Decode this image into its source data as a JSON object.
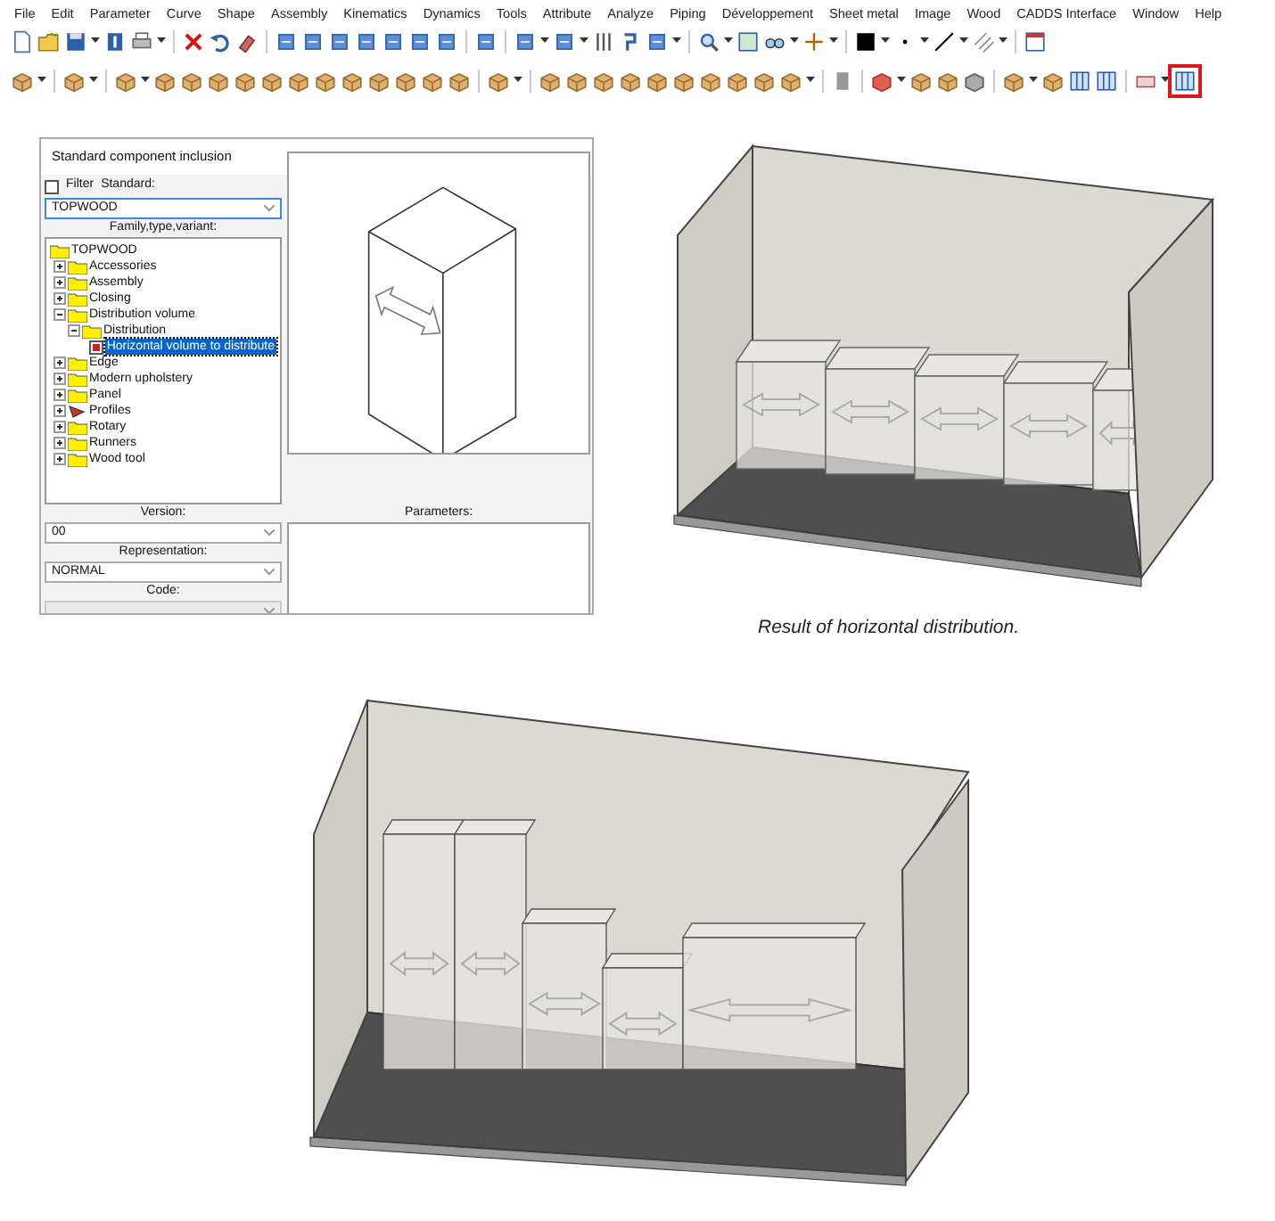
{
  "menu": [
    "File",
    "Edit",
    "Parameter",
    "Curve",
    "Shape",
    "Assembly",
    "Kinematics",
    "Dynamics",
    "Tools",
    "Attribute",
    "Analyze",
    "Piping",
    "Développement",
    "Sheet metal",
    "Image",
    "Wood",
    "CADDS Interface",
    "Window",
    "Help"
  ],
  "lower_toolbar": {
    "highlight_last": true
  },
  "dialog": {
    "title": "Standard component inclusion",
    "filter": {
      "label": "Filter",
      "checked": false
    },
    "standard": {
      "label": "Standard:",
      "value": "TOPWOOD"
    },
    "tree_label": "Family,type,variant:",
    "tree": [
      {
        "label": "TOPWOOD",
        "kind": "folder",
        "selected": false,
        "children": [
          {
            "label": "Accessories",
            "kind": "folder",
            "expanded": false,
            "selected": false
          },
          {
            "label": "Assembly",
            "kind": "folder",
            "expanded": false,
            "selected": false
          },
          {
            "label": "Closing",
            "kind": "folder",
            "expanded": false,
            "selected": false
          },
          {
            "label": "Distribution volume",
            "kind": "folder",
            "expanded": true,
            "selected": false,
            "children": [
              {
                "label": "Distribution",
                "kind": "folder",
                "expanded": true,
                "selected": false,
                "children": [
                  {
                    "label": "Horizontal volume to distribute",
                    "kind": "component",
                    "selected": true
                  }
                ]
              }
            ]
          },
          {
            "label": "Edge",
            "kind": "folder",
            "expanded": false,
            "selected": false
          },
          {
            "label": "Modern upholstery",
            "kind": "folder",
            "expanded": false,
            "selected": false
          },
          {
            "label": "Panel",
            "kind": "folder",
            "expanded": false,
            "selected": false
          },
          {
            "label": "Profiles",
            "kind": "profile",
            "expanded": false,
            "selected": false
          },
          {
            "label": "Rotary",
            "kind": "folder",
            "expanded": false,
            "selected": false
          },
          {
            "label": "Runners",
            "kind": "folder",
            "expanded": false,
            "selected": false
          },
          {
            "label": "Wood tool",
            "kind": "folder",
            "expanded": false,
            "selected": false
          }
        ]
      }
    ],
    "parameters_label": "Parameters:",
    "fields": [
      {
        "label": "Version:",
        "value": "00",
        "disabled": false
      },
      {
        "label": "Representation:",
        "value": "NORMAL",
        "disabled": false
      },
      {
        "label": "Code:",
        "disabled": true
      }
    ]
  },
  "caption": "Result of horizontal distribution."
}
